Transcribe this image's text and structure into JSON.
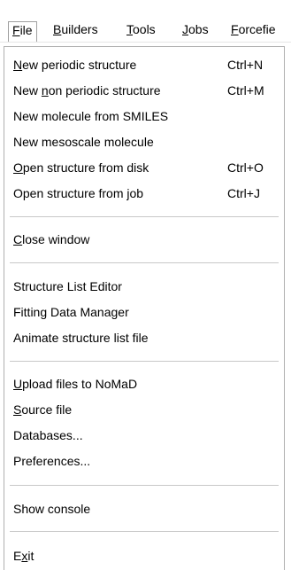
{
  "menubar": {
    "items": [
      {
        "label": "File"
      },
      {
        "label": "Builders"
      },
      {
        "label": "Tools"
      },
      {
        "label": "Jobs"
      },
      {
        "label": "Forcefie"
      }
    ]
  },
  "file_menu": {
    "groups": [
      [
        {
          "label_pre": "",
          "mnemonic": "N",
          "label_post": "ew periodic structure",
          "shortcut": "Ctrl+N"
        },
        {
          "label_pre": "New ",
          "mnemonic": "n",
          "label_post": "on periodic structure",
          "shortcut": "Ctrl+M"
        },
        {
          "label_pre": "New molecule from SMILES",
          "mnemonic": "",
          "label_post": "",
          "shortcut": ""
        },
        {
          "label_pre": "New mesoscale molecule",
          "mnemonic": "",
          "label_post": "",
          "shortcut": ""
        },
        {
          "label_pre": "",
          "mnemonic": "O",
          "label_post": "pen structure from disk",
          "shortcut": "Ctrl+O"
        },
        {
          "label_pre": "Open structure from ",
          "mnemonic": "j",
          "label_post": "ob",
          "shortcut": "Ctrl+J"
        }
      ],
      [
        {
          "label_pre": "",
          "mnemonic": "C",
          "label_post": "lose window",
          "shortcut": ""
        }
      ],
      [
        {
          "label_pre": "Structure List Editor",
          "mnemonic": "",
          "label_post": "",
          "shortcut": ""
        },
        {
          "label_pre": "Fitting Data Manager",
          "mnemonic": "",
          "label_post": "",
          "shortcut": ""
        },
        {
          "label_pre": "Animate structure list file",
          "mnemonic": "",
          "label_post": "",
          "shortcut": ""
        }
      ],
      [
        {
          "label_pre": "",
          "mnemonic": "U",
          "label_post": "pload files to NoMaD",
          "shortcut": ""
        },
        {
          "label_pre": "",
          "mnemonic": "S",
          "label_post": "ource file",
          "shortcut": ""
        },
        {
          "label_pre": "Databases...",
          "mnemonic": "",
          "label_post": "",
          "shortcut": ""
        },
        {
          "label_pre": "Preferences...",
          "mnemonic": "",
          "label_post": "",
          "shortcut": ""
        }
      ],
      [
        {
          "label_pre": "Show console",
          "mnemonic": "",
          "label_post": "",
          "shortcut": ""
        }
      ],
      [
        {
          "label_pre": "E",
          "mnemonic": "x",
          "label_post": "it",
          "shortcut": ""
        }
      ]
    ]
  }
}
